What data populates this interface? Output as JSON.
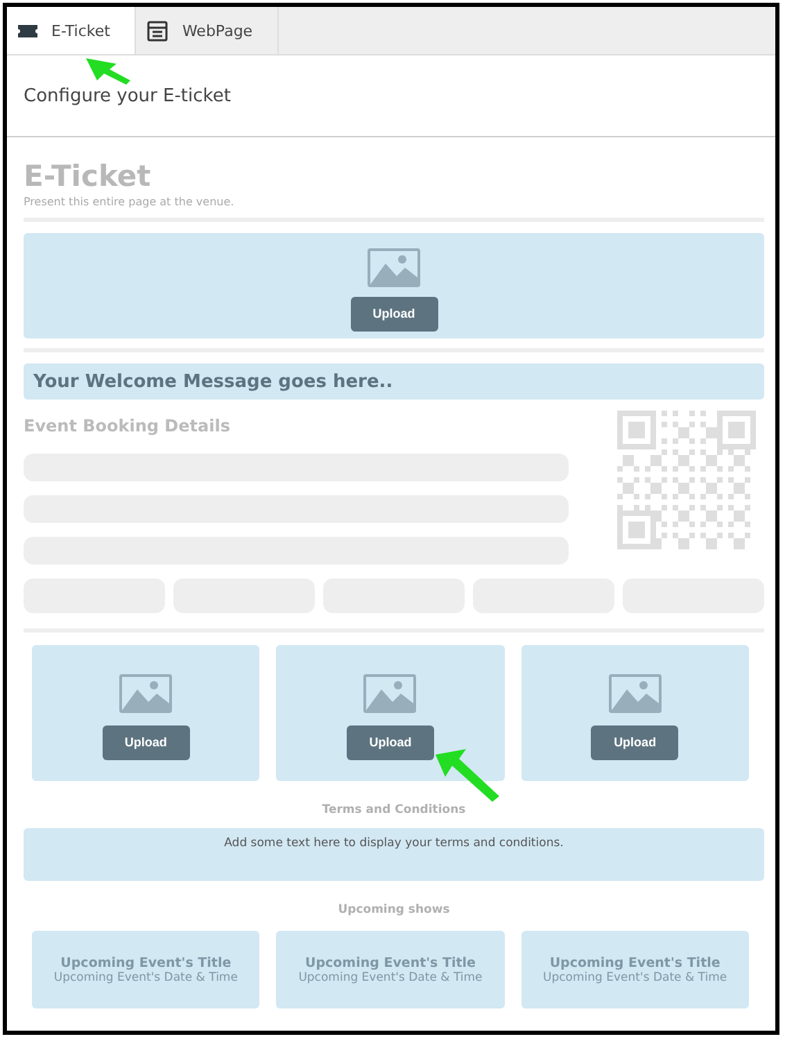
{
  "tabs": [
    {
      "label": "E-Ticket",
      "selected": true
    },
    {
      "label": "WebPage",
      "selected": false
    }
  ],
  "header": {
    "title": "Configure your E-ticket"
  },
  "ticket": {
    "title": "E-Ticket",
    "subtitle": "Present this entire page at the venue.",
    "banner": {
      "button": "Upload"
    },
    "welcome": "Your Welcome Message goes here..",
    "booking": {
      "heading": "Event Booking Details"
    },
    "images": [
      {
        "button": "Upload"
      },
      {
        "button": "Upload"
      },
      {
        "button": "Upload"
      }
    ],
    "terms": {
      "heading": "Terms and Conditions",
      "text": "Add some text here to display your terms and conditions."
    },
    "upcoming": {
      "heading": "Upcoming shows",
      "events": [
        {
          "title": "Upcoming Event's Title",
          "when": "Upcoming Event's Date & Time"
        },
        {
          "title": "Upcoming Event's Title",
          "when": "Upcoming Event's Date & Time"
        },
        {
          "title": "Upcoming Event's Title",
          "when": "Upcoming Event's Date & Time"
        }
      ]
    }
  }
}
